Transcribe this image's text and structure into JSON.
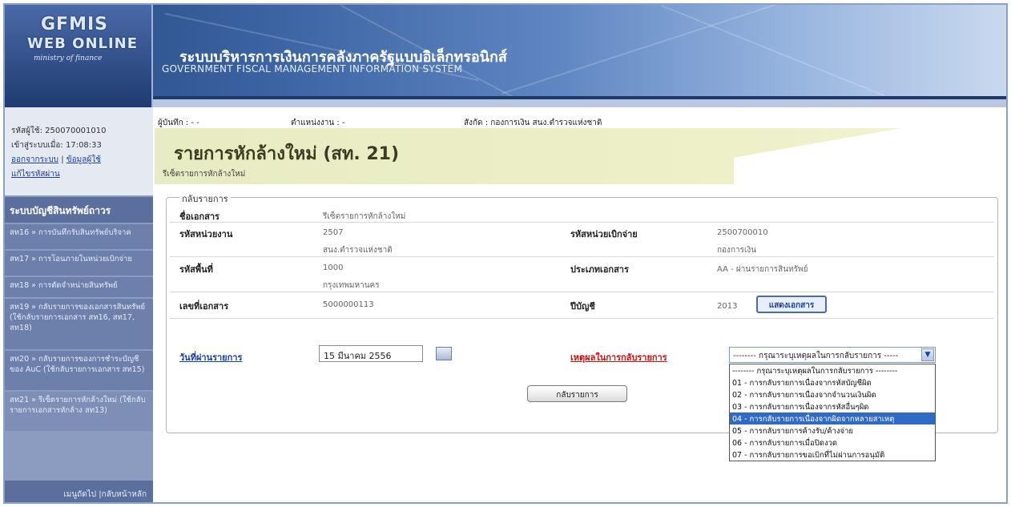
{
  "logo": {
    "line1": "GFMIS",
    "line2": "WEB ONLINE",
    "line3": "ministry of finance"
  },
  "banner": {
    "title_th": "ระบบบริหารการเงินการคลังภาครัฐแบบอิเล็กทรอนิกส์",
    "title_en": "GOVERNMENT FISCAL MANAGEMENT INFORMATION SYSTEM"
  },
  "user": {
    "id_label": "รหัสผู้ใช้: 250070001010",
    "login_label": "เข้าสู่ระบบเมื่อ: 17:08:33",
    "logout_link": "ออกจากระบบ",
    "sep": "|",
    "profile_link": "ข้อมูลผู้ใช้",
    "password_link": "แก้ไขรหัสผ่าน"
  },
  "menu": {
    "header": "ระบบบัญชีสินทรัพย์ถาวร",
    "items": [
      {
        "label": "สท16 » การบันทึกรับสินทรัพย์บริจาค"
      },
      {
        "label": "สท17 » การโอนภายในหน่วยเบิกจ่าย"
      },
      {
        "label": "สท18 » การตัดจำหน่ายสินทรัพย์"
      },
      {
        "label": "สท19 » กลับรายการของเอกสารสินทรัพย์ (ใช้กลับรายการเอกสาร สท16, สท17, สท18)"
      },
      {
        "label": "สท20 » กลับรายการของการชำระบัญชีของ AuC (ใช้กลับรายการเอกสาร สท15)"
      },
      {
        "label": "สท21 » รีเซ็ตรายการหักล้างใหม่ (ใช้กลับรายการเอกสารหักล้าง สท13)"
      }
    ],
    "footer": "เมนูถัดไป |กลับหน้าหลัก"
  },
  "info": {
    "recorder": "ผู้บันทึก : - -",
    "division": "ตำแหน่งงาน : -",
    "affiliation": "สังกัด : กองการเงิน สนง.ตำรวจแห่งชาติ"
  },
  "page": {
    "title": "รายการหักล้างใหม่ (สท. 21)",
    "subtitle": "รีเซ็ตรายการหักล้างใหม่"
  },
  "form": {
    "legend": "กลับรายการ",
    "doc_name_label": "ชื่อเอกสาร",
    "doc_name_value": "รีเซ็ตรายการหักล้างใหม่",
    "agency_code_label": "รหัสหน่วยงาน",
    "agency_code_value": "2507",
    "agency_name_value": "สนง.ตำรวจแห่งชาติ",
    "disb_unit_label": "รหัสหน่วยเบิกจ่าย",
    "disb_unit_value": "2500700010",
    "disb_unit_name": "กองการเงิน",
    "area_code_label": "รหัสพื้นที่",
    "area_code_value": "1000",
    "area_name_value": "กรุงเทพมหานคร",
    "doc_type_label": "ประเภทเอกสาร",
    "doc_type_value": "AA - ผ่านรายการสินทรัพย์",
    "doc_no_label": "เลขที่เอกสาร",
    "doc_no_value": "5000000113",
    "fiscal_year_label": "ปีบัญชี",
    "fiscal_year_value": "2013",
    "show_doc_button": "แสดงเอกสาร",
    "posting_date_label": "วันที่ผ่านรายการ",
    "posting_date_value": "15 มีนาคม 2556",
    "reason_label": "เหตุผลในการกลับรายการ",
    "reason_selected": "-------- กรุณาระบุเหตุผลในการกลับรายการ -----",
    "reason_options": [
      "-------- กรุณาระบุเหตุผลในการกลับรายการ --------",
      "01 - การกลับรายการเนื่องจากรหัสบัญชีผิด",
      "02 - การกลับรายการเนื่องจากจำนวนเงินผิด",
      "03 - การกลับรายการเนื่องจากรหัสอื่นๆผิด",
      "04 - การกลับรายการเนื่องจากผิดจากหลายสาเหตุ",
      "05 - การกลับรายการค้างรับ/ค้างจ่าย",
      "06 - การกลับรายการเมื่อปิดงวด",
      "07 - การกลับรายการขอเบิกที่ไม่ผ่านการอนุมัติ"
    ],
    "reason_highlighted_index": 4,
    "reverse_button": "กลับรายการ"
  }
}
